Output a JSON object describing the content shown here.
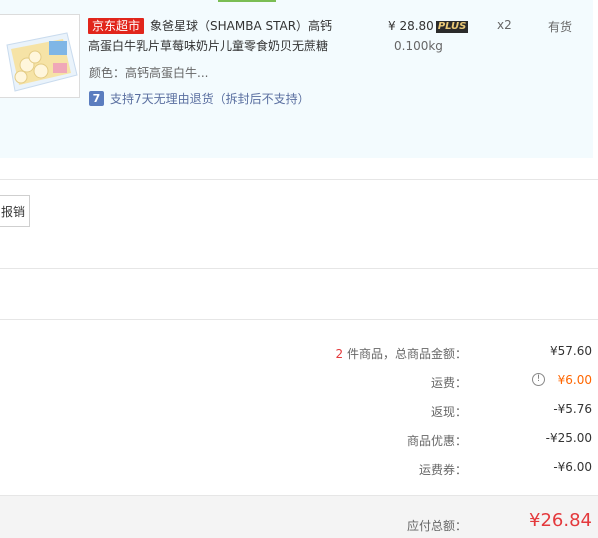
{
  "product": {
    "store_badge": "京东超市",
    "title": "象爸星球（SHAMBA STAR）高钙高蛋白牛乳片草莓味奶片儿童零食奶贝无蔗糖",
    "price": "¥ 28.80",
    "plus_badge": "PLUS",
    "weight": "0.100kg",
    "quantity": "x2",
    "stock": "有货",
    "color_label": "颜色：高钙高蛋白牛...",
    "return_icon": "7",
    "return_policy": "支持7天无理由退货（拆封后不支持）"
  },
  "invoice": {
    "button_label": "报销"
  },
  "summary": {
    "item_count": "2",
    "items_label": " 件商品，总商品金额：",
    "items_total": "¥57.60",
    "shipping_label": "运费：",
    "shipping_value": "¥6.00",
    "cashback_label": "返现：",
    "cashback_value": "-¥5.76",
    "discount_label": "商品优惠：",
    "discount_value": "-¥25.00",
    "coupon_label": "运费券：",
    "coupon_value": "-¥6.00",
    "total_label": "应付总额：",
    "total_value": "¥26.84"
  },
  "colors": {
    "accent_red": "#e4393c",
    "shipping_orange": "#ff6600",
    "product_bg": "#f3fbfe"
  }
}
